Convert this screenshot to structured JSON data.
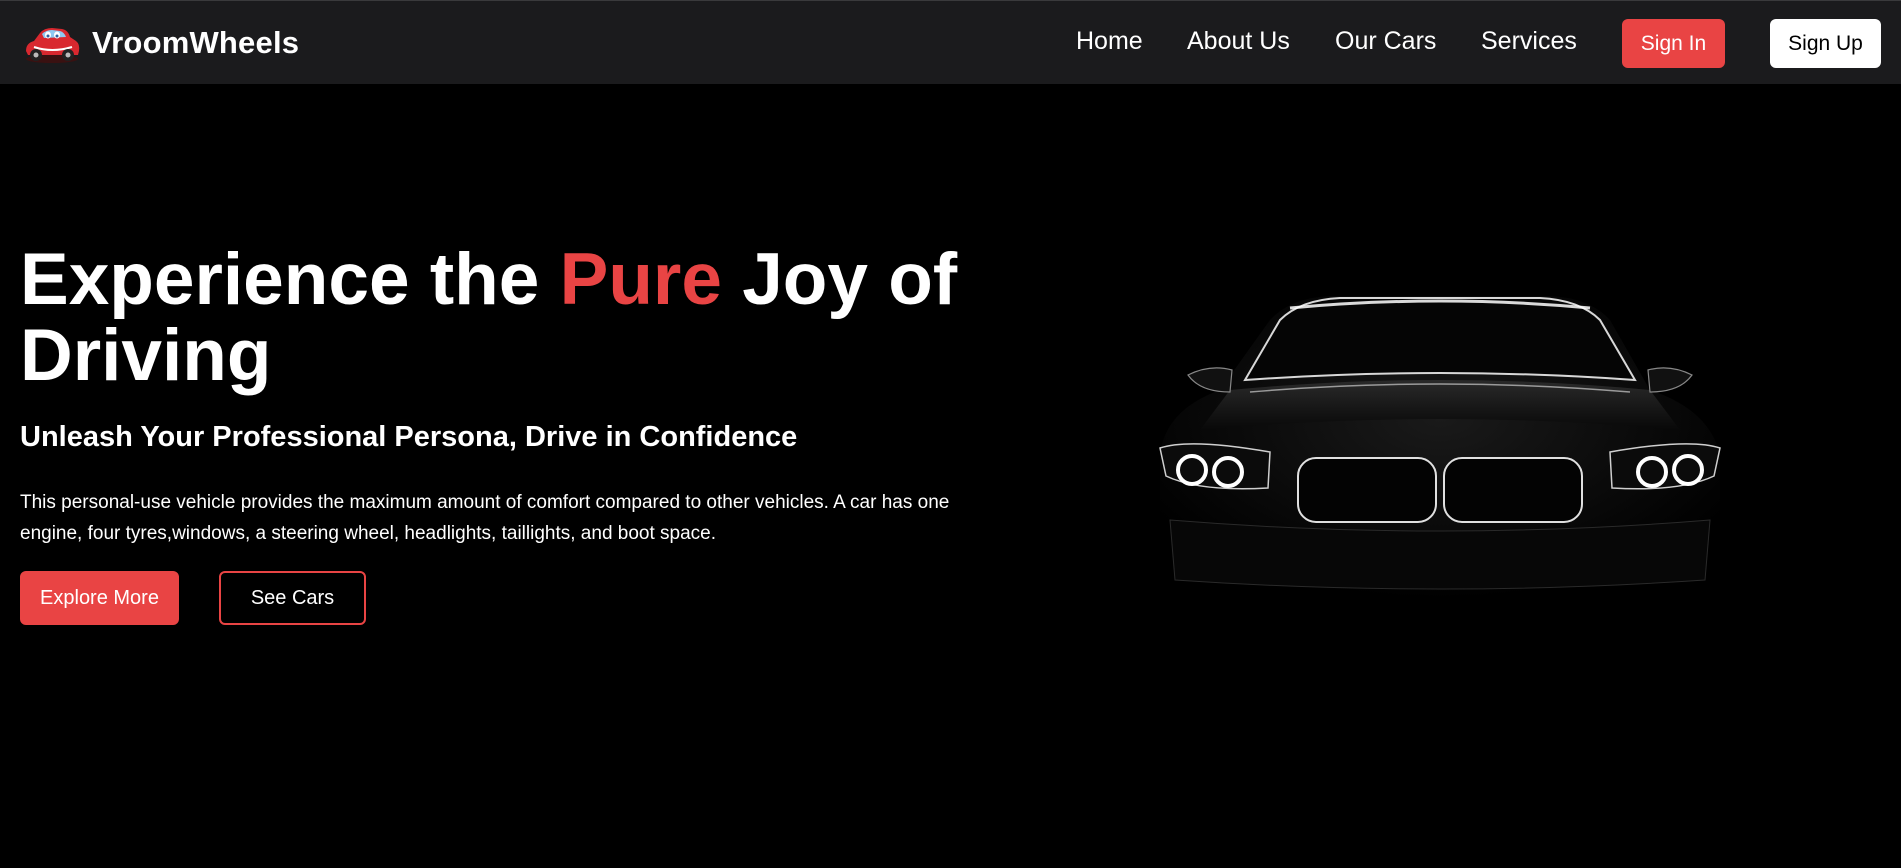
{
  "brand": {
    "name": "VroomWheels",
    "logo_icon": "red-cartoon-car-icon"
  },
  "nav": {
    "links": [
      "Home",
      "About Us",
      "Our Cars",
      "Services"
    ],
    "sign_in": "Sign In",
    "sign_up": "Sign Up"
  },
  "hero": {
    "title_part1": "Experience the ",
    "title_accent": "Pure",
    "title_part2": " Joy of Driving",
    "subtitle": "Unleash Your Professional Persona, Drive in Confidence",
    "description": "This personal-use vehicle provides the maximum amount of comfort compared to other vehicles. A car has one engine, four tyres,windows, a steering wheel, headlights, taillights, and boot space.",
    "primary_button": "Explore More",
    "secondary_button": "See Cars",
    "image": "black-car-front-headlights"
  },
  "colors": {
    "accent": "#e94444",
    "navbar_bg": "#1b1b1d",
    "page_bg": "#000000",
    "text": "#ffffff"
  }
}
